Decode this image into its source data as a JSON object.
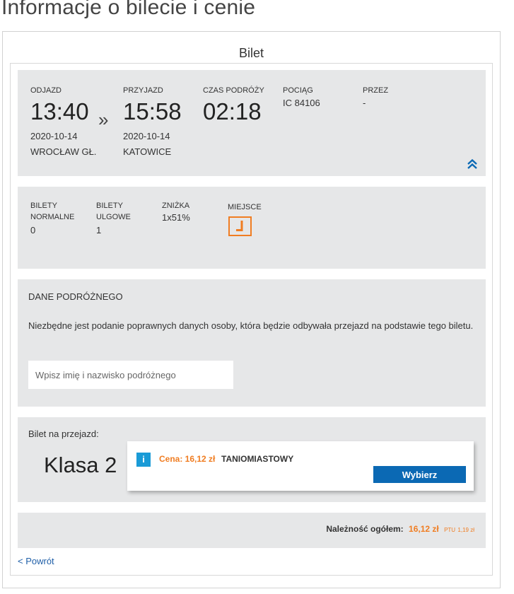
{
  "page": {
    "heading": "Informacje o bilecie i cenie",
    "section_title": "Bilet"
  },
  "journey": {
    "departure": {
      "label": "ODJAZD",
      "time": "13:40",
      "date": "2020-10-14",
      "station": "WROCŁAW GŁ."
    },
    "arrow": "»",
    "arrival": {
      "label": "PRZYJAZD",
      "time": "15:58",
      "date": "2020-10-14",
      "station": "KATOWICE"
    },
    "duration": {
      "label": "CZAS PODRÓŻY",
      "value": "02:18"
    },
    "train": {
      "label": "POCIĄG",
      "value": "IC 84106"
    },
    "via": {
      "label": "PRZEZ",
      "value": "-"
    },
    "collapse_icon": "double-chevron-up-icon"
  },
  "tickets": {
    "normal": {
      "label_line1": "BILETY",
      "label_line2": "NORMALNE",
      "value": "0"
    },
    "reduced": {
      "label_line1": "BILETY",
      "label_line2": "ULGOWE",
      "value": "1"
    },
    "discount": {
      "label": "ZNIŻKA",
      "value": "1x51%"
    },
    "seat": {
      "label": "MIEJSCE",
      "icon": "seat-icon"
    }
  },
  "passenger": {
    "title": "DANE PODRÓŻNEGO",
    "description": "Niezbędne jest podanie poprawnych danych osoby, która będzie odbywała przejazd na podstawie tego biletu.",
    "name_value": "",
    "name_placeholder": "Wpisz imię i nazwisko podróżnego"
  },
  "ticket_class": {
    "label": "Bilet na przejazd:",
    "class_name": "Klasa 2",
    "offer": {
      "info_icon": "i",
      "price_text": "Cena: 16,12 zł",
      "tariff": "TANIOMIASTOWY",
      "select_label": "Wybierz"
    }
  },
  "summary": {
    "total_label": "Należność ogółem:",
    "total_value": "16,12 zł",
    "ptu_label": "PTU",
    "ptu_value": "1,19 zł"
  },
  "nav": {
    "back_label": "< Powrót"
  },
  "colors": {
    "accent_orange": "#f07d22",
    "primary_blue": "#0b69b4",
    "info_blue": "#1a9bd7",
    "panel_bg": "#e6e7e8"
  }
}
